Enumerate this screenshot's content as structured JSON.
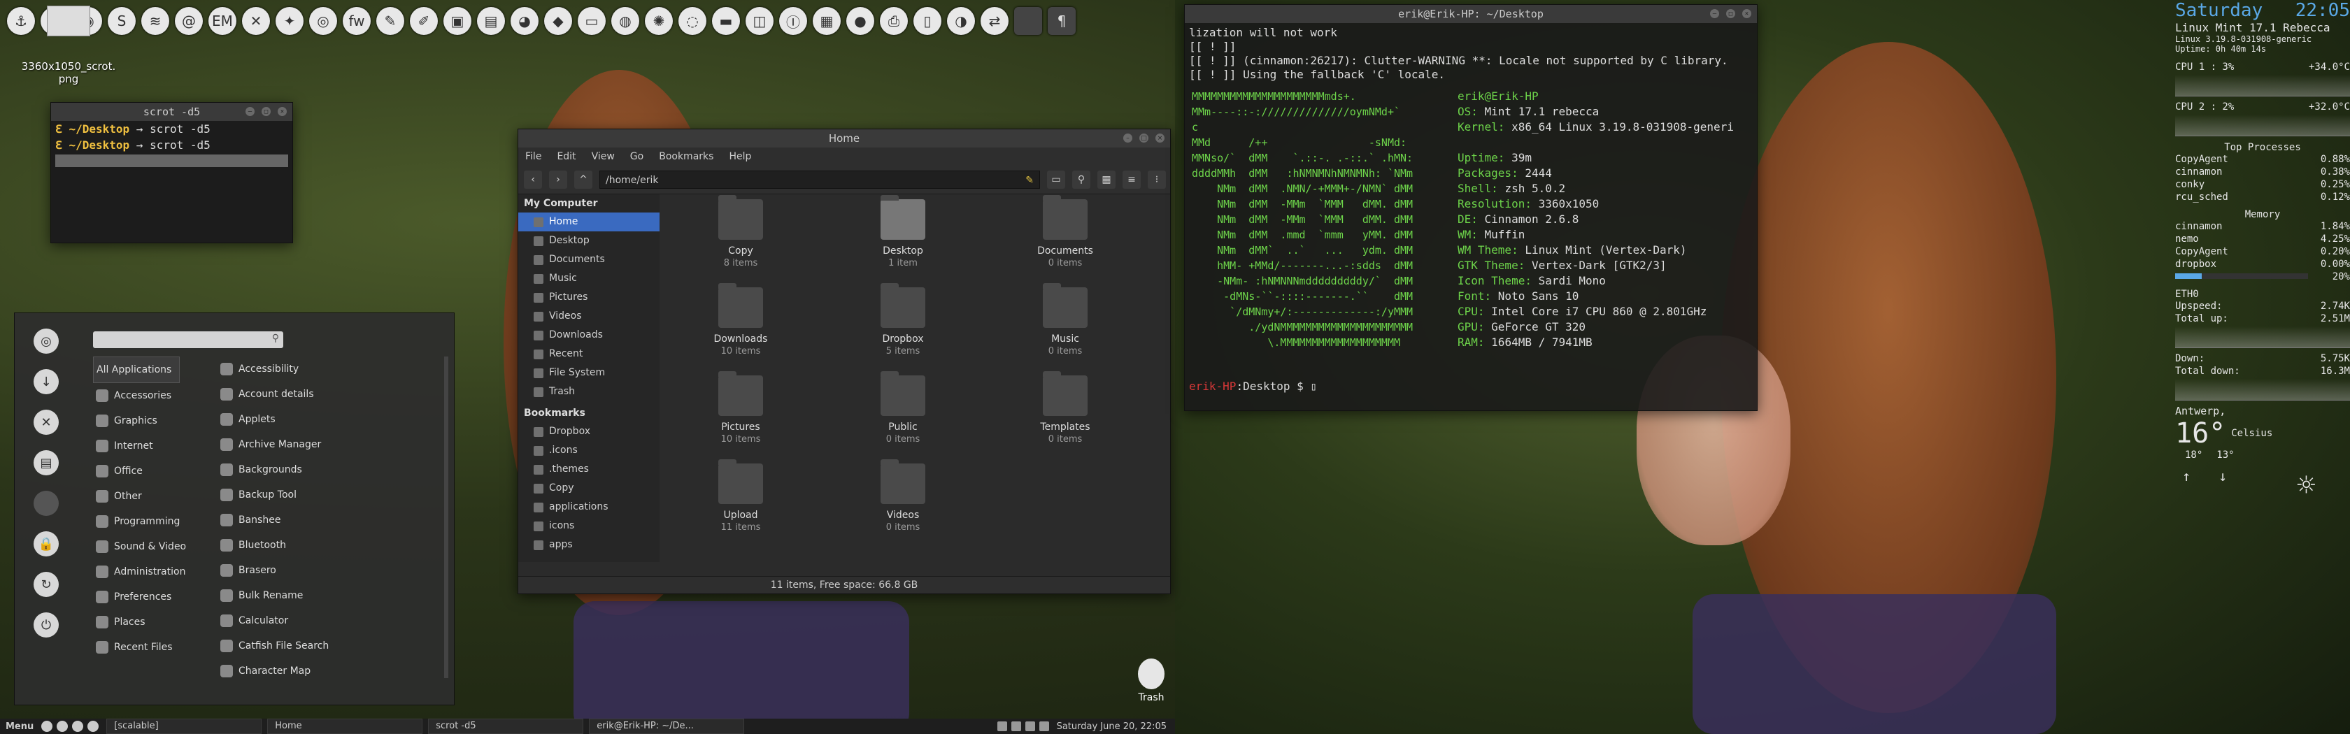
{
  "desktop_file": {
    "name": "3360x1050_scrot.\npng"
  },
  "topbar_icons": [
    "anchor-icon",
    "circle-icon",
    "firefox-icon",
    "s-icon",
    "wifi-icon",
    "at-icon",
    "em-icon",
    "tools-icon",
    "bird-icon",
    "chrome-icon",
    "fw-icon",
    "brush-icon",
    "pen-icon",
    "camera-icon",
    "save-icon",
    "github-icon",
    "shield-icon",
    "screen-icon",
    "palette-icon",
    "aperture-icon",
    "globe-icon",
    "drive-icon",
    "slot-icon",
    "lock-icon",
    "grid-icon",
    "circle2-icon",
    "print-icon",
    "book-icon",
    "globe2-icon",
    "swap-icon",
    "blank-icon",
    "text-icon"
  ],
  "small_terminal": {
    "title": "scrot -d5",
    "lines": [
      {
        "prompt": "~/Desktop",
        "cmd": "scrot -d5"
      },
      {
        "prompt": "~/Desktop",
        "cmd": "scrot -d5"
      }
    ]
  },
  "menu": {
    "categories": [
      "All Applications",
      "Accessories",
      "Graphics",
      "Internet",
      "Office",
      "Other",
      "Programming",
      "Sound & Video",
      "Administration",
      "Preferences",
      "Places",
      "Recent Files"
    ],
    "apps": [
      "Accessibility",
      "Account details",
      "Applets",
      "Archive Manager",
      "Backgrounds",
      "Backup Tool",
      "Banshee",
      "Bluetooth",
      "Brasero",
      "Bulk Rename",
      "Calculator",
      "Catfish File Search",
      "Character Map"
    ]
  },
  "filemanager": {
    "title": "Home",
    "menu": [
      "File",
      "Edit",
      "View",
      "Go",
      "Bookmarks",
      "Help"
    ],
    "location": "/home/erik",
    "sidebar": {
      "my_computer_header": "My Computer",
      "my_computer": [
        "Home",
        "Desktop",
        "Documents",
        "Music",
        "Pictures",
        "Videos",
        "Downloads",
        "Recent",
        "File System",
        "Trash"
      ],
      "bookmarks_header": "Bookmarks",
      "bookmarks": [
        "Dropbox",
        ".icons",
        ".themes",
        "Copy",
        "applications",
        "icons",
        "apps"
      ]
    },
    "items": [
      {
        "name": "Copy",
        "sub": "8 items"
      },
      {
        "name": "Desktop",
        "sub": "1 item"
      },
      {
        "name": "Documents",
        "sub": "0 items"
      },
      {
        "name": "Downloads",
        "sub": "10 items"
      },
      {
        "name": "Dropbox",
        "sub": "5 items"
      },
      {
        "name": "Music",
        "sub": "0 items"
      },
      {
        "name": "Pictures",
        "sub": "10 items"
      },
      {
        "name": "Public",
        "sub": "0 items"
      },
      {
        "name": "Templates",
        "sub": "0 items"
      },
      {
        "name": "Upload",
        "sub": "11 items"
      },
      {
        "name": "Videos",
        "sub": "0 items"
      }
    ],
    "status": "11 items, Free space: 66.8 GB"
  },
  "big_terminal": {
    "title": "erik@Erik-HP: ~/Desktop",
    "top_lines": [
      "lization will not work",
      "[[ ! ]]",
      "[[ ! ]] (cinnamon:26217): Clutter-WARNING **: Locale not supported by C library.",
      "[[ ! ]] Using the fallback 'C' locale."
    ],
    "neo_art": "MMMMMMMMMMMMMMMMMMMMMmds+.\nMMm----::-://////////////oymNMd+`\nc\nMMd      /++                -sNMd:\nMMNso/`  dMM    `.::-. .-::.` .hMN:\nddddMMh  dMM   :hNMNMNhNMNMNh: `NMm\n    NMm  dMM  .NMN/-+MMM+-/NMN` dMM\n    NMm  dMM  -MMm  `MMM   dMM. dMM\n    NMm  dMM  -MMm  `MMM   dMM. dMM\n    NMm  dMM  .mmd  `mmm   yMM. dMM\n    NMm  dMM`  ..`   ...   ydm. dMM\n    hMM- +MMd/-------...-:sdds  dMM\n    -NMm- :hNMNNNmdddddddddy/`  dMM\n     -dMNs-``-::::-------.``    dMM\n      `/dMNmy+/:-------------:/yMMM\n         ./ydNMMMMMMMMMMMMMMMMMMMMM\n            \\.MMMMMMMMMMMMMMMMMMM",
    "user": "erik@Erik-HP",
    "info": [
      {
        "k": "OS:",
        "v": "Mint 17.1 rebecca"
      },
      {
        "k": "Kernel:",
        "v": "x86_64 Linux 3.19.8-031908-generi"
      },
      {
        "k": "",
        "v": ""
      },
      {
        "k": "Uptime:",
        "v": "39m"
      },
      {
        "k": "Packages:",
        "v": "2444"
      },
      {
        "k": "Shell:",
        "v": "zsh 5.0.2"
      },
      {
        "k": "Resolution:",
        "v": "3360x1050"
      },
      {
        "k": "DE:",
        "v": "Cinnamon 2.6.8"
      },
      {
        "k": "WM:",
        "v": "Muffin"
      },
      {
        "k": "WM Theme:",
        "v": "Linux Mint (Vertex-Dark)"
      },
      {
        "k": "GTK Theme:",
        "v": "Vertex-Dark [GTK2/3]"
      },
      {
        "k": "Icon Theme:",
        "v": "Sardi Mono"
      },
      {
        "k": "Font:",
        "v": "Noto Sans 10"
      },
      {
        "k": "CPU:",
        "v": "Intel Core i7 CPU 860 @ 2.801GHz"
      },
      {
        "k": "GPU:",
        "v": "GeForce GT 320"
      },
      {
        "k": "RAM:",
        "v": "1664MB / 7941MB"
      }
    ],
    "prompt_host": "erik-HP",
    "prompt_path": ":Desktop $"
  },
  "conky": {
    "day": "Saturday",
    "time": "22:05",
    "os": "Linux Mint 17.1 Rebecca",
    "kernel": "Linux 3.19.8-031908-generic",
    "uptime": "Uptime: 0h 40m 14s",
    "cpu1": {
      "label": "CPU 1 : 3%",
      "temp": "+34.0°C",
      "level": 0.03
    },
    "cpu2": {
      "label": "CPU 2 : 2%",
      "temp": "+32.0°C",
      "level": 0.02
    },
    "top_header": "Top Processes",
    "top": [
      {
        "n": "CopyAgent",
        "v": "0.88%"
      },
      {
        "n": "cinnamon",
        "v": "0.38%"
      },
      {
        "n": "conky",
        "v": "0.25%"
      },
      {
        "n": "rcu_sched",
        "v": "0.12%"
      }
    ],
    "mem_header": "Memory",
    "mem": [
      {
        "n": "cinnamon",
        "v": "1.84%"
      },
      {
        "n": "nemo",
        "v": "4.25%"
      },
      {
        "n": "CopyAgent",
        "v": "0.20%"
      },
      {
        "n": "dropbox",
        "v": "0.00%"
      }
    ],
    "mem_total": "20%",
    "mem_level": 0.2,
    "net_if": "ETH0",
    "upspeed": {
      "k": "Upspeed:",
      "v": "2.74K"
    },
    "total_up": {
      "k": "Total up:",
      "v": "2.51M"
    },
    "down": {
      "k": "Down:",
      "v": "5.75K"
    },
    "total_down": {
      "k": "Total down:",
      "v": "16.3M"
    },
    "city": "Antwerp,",
    "temp": "16°",
    "unit": "Celsius",
    "high": "18°",
    "low": "13°"
  },
  "trash_label": "Trash",
  "panel": {
    "menu_label": "Menu",
    "tasks": [
      "[scalable]",
      "Home",
      "scrot -d5",
      "erik@Erik-HP: ~/De..."
    ],
    "clock": "Saturday June 20, 22:05"
  }
}
